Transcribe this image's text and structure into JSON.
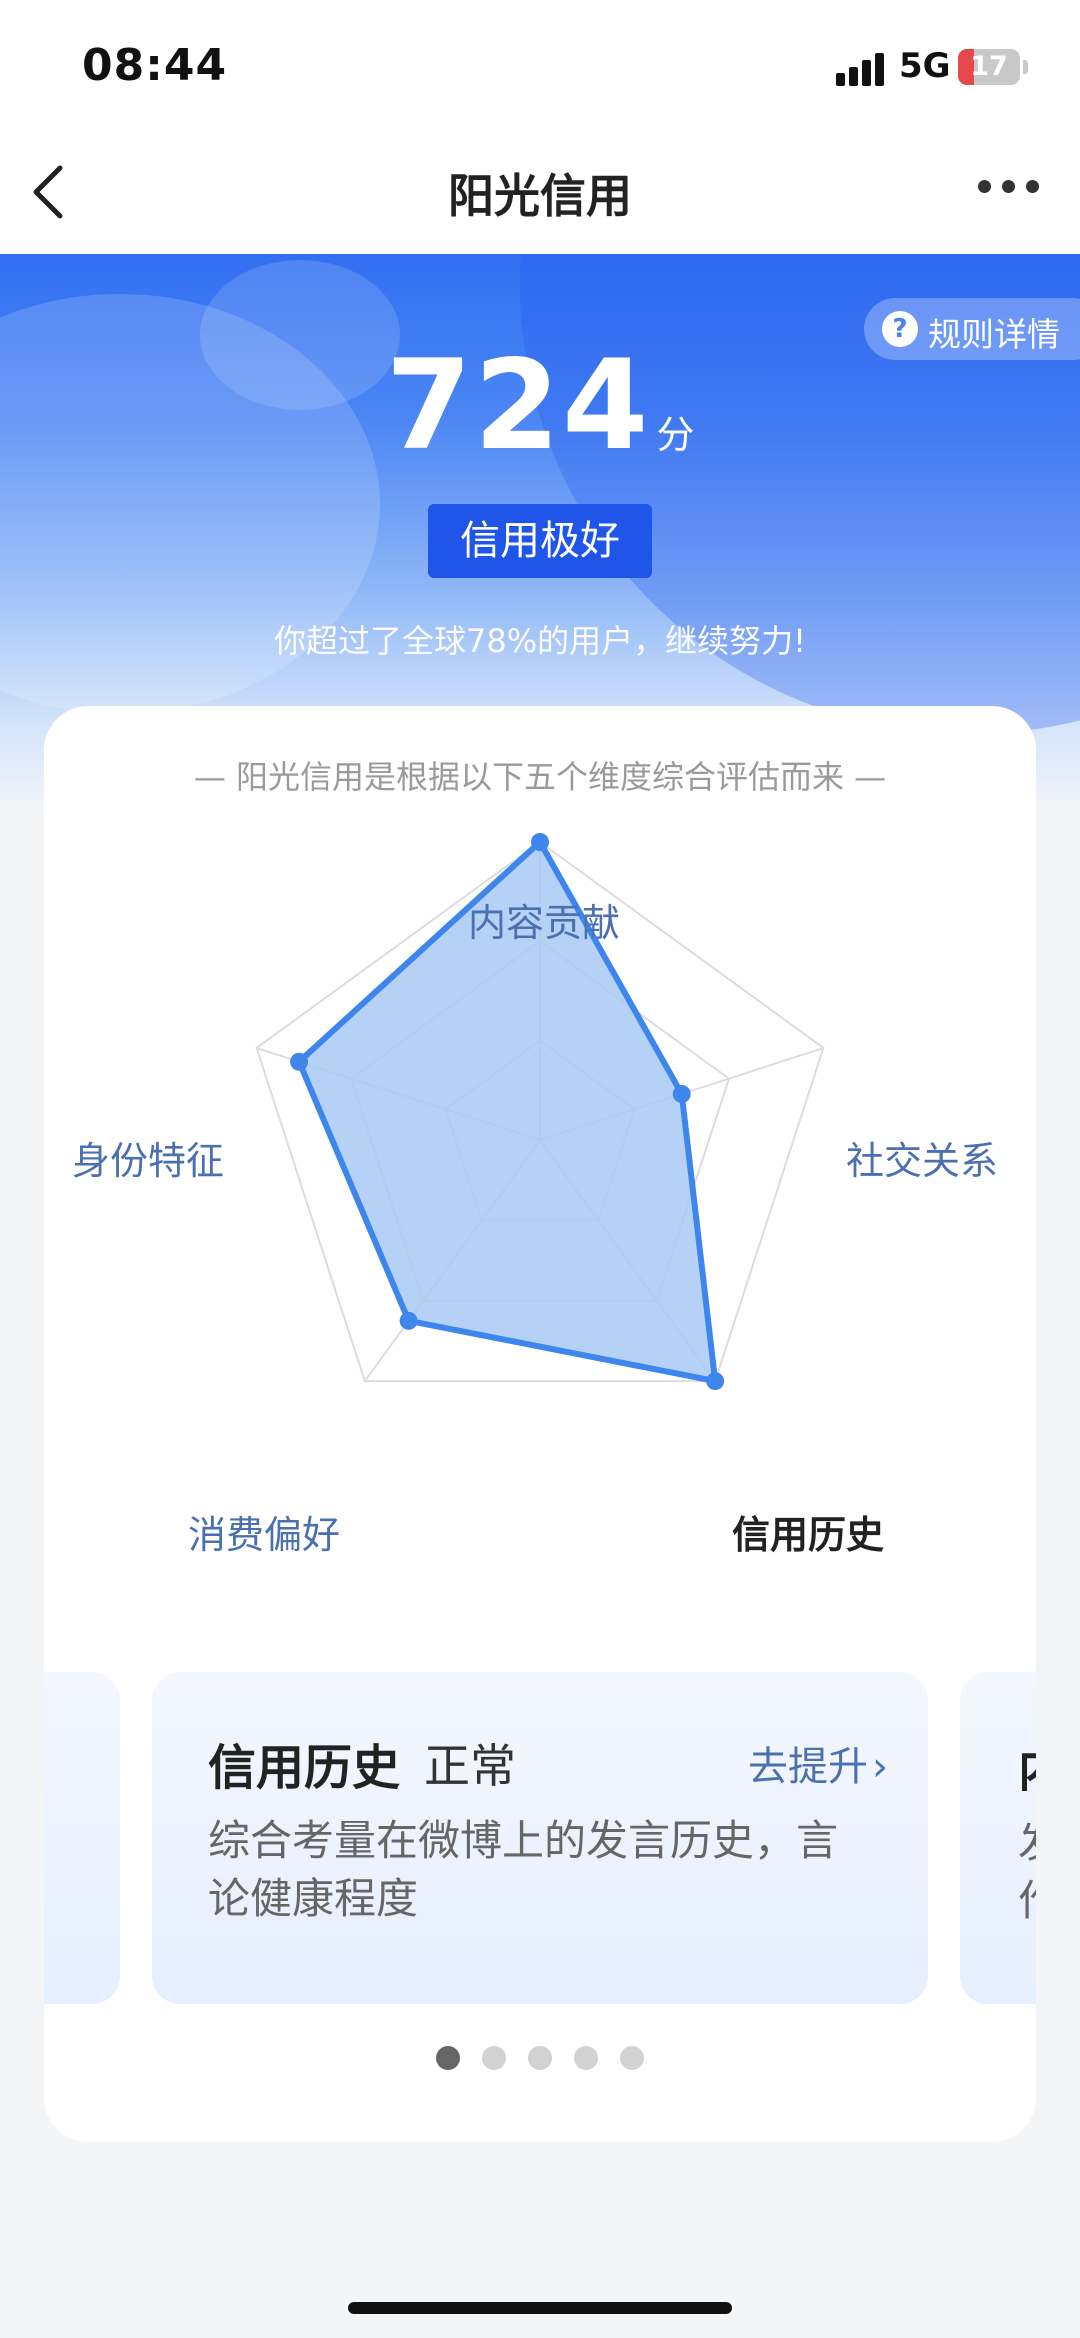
{
  "status_bar": {
    "time": "08:44",
    "network": "5G",
    "battery": "17"
  },
  "nav": {
    "title": "阳光信用",
    "back_icon": "chevron-left-icon",
    "more_icon": "more-dots-icon"
  },
  "hero": {
    "rules_label": "规则详情",
    "score": "724",
    "score_unit": "分",
    "level": "信用极好",
    "subtitle": "你超过了全球78%的用户，继续努力!"
  },
  "card": {
    "caption": "— 阳光信用是根据以下五个维度综合评估而来 —"
  },
  "radar": {
    "dimensions": [
      {
        "label": "内容贡献",
        "value": 1.0
      },
      {
        "label": "社交关系",
        "value": 0.5
      },
      {
        "label": "信用历史",
        "value": 1.0
      },
      {
        "label": "消费偏好",
        "value": 0.75
      },
      {
        "label": "身份特征",
        "value": 0.85
      }
    ],
    "active_dimension": "信用历史",
    "fill_color": "#a9c9f5",
    "stroke_color": "#3f86ec",
    "grid_color": "#dcdcdc"
  },
  "info": {
    "title": "信用历史",
    "status": "正常",
    "link": "去提升",
    "description": "综合考量在微博上的发言历史，言论健康程度",
    "peek_title": "内",
    "peek_desc_1": "发",
    "peek_desc_2": "作"
  },
  "pager": {
    "count": 5,
    "active": 0
  }
}
